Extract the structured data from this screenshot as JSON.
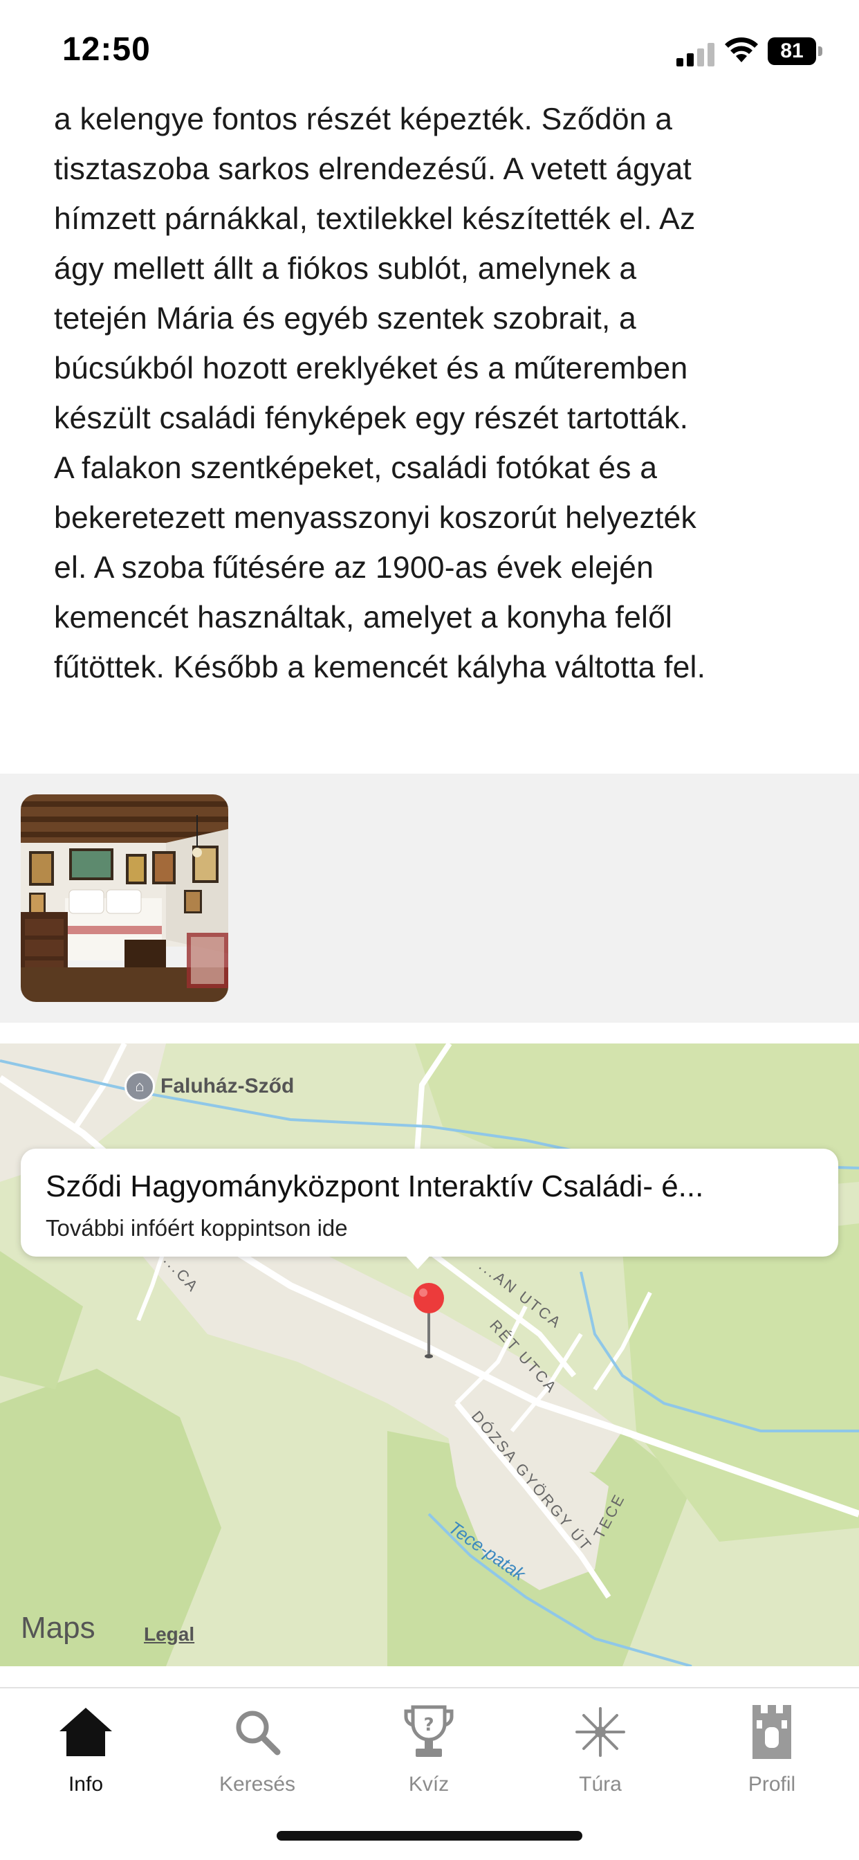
{
  "status_bar": {
    "time": "12:50",
    "battery_percent": "81"
  },
  "article": {
    "lines": [
      "a kelengye fontos részét képezték. Sződön a",
      "tisztaszoba sarkos elrendezésű. A vetett ágyat",
      "hímzett párnákkal, textilekkel készítették el. Az",
      "ágy mellett állt a fiókos sublót, amelynek a",
      "tetején Mária és egyéb szentek szobrait, a",
      "búcsúkból hozott ereklyéket és a műteremben",
      "készült családi fényképek egy részét tartották.",
      "A falakon szentképeket, családi fotókat és a",
      "bekeretezett menyasszonyi koszorút helyezték",
      "el. A szoba fűtésére az 1900-as évek elején",
      "kemencét használtak, amelyet a konyha felől",
      "fűtöttek. Később a kemencét kályha váltotta fel."
    ]
  },
  "map": {
    "poi_label": "Faluház-Sződ",
    "callout_title": "Sződi Hagyományközpont Interaktív Családi- é...",
    "callout_subtitle": "További infóért koppintson ide",
    "street_labels": [
      "...AN UTCA",
      "RÉT UTCA",
      "DÓZSA GYÖRGY ÚT",
      "TECE",
      "...CA"
    ],
    "stream_label": "Tece-patak",
    "brand": "Maps",
    "legal": "Legal"
  },
  "tabbar": {
    "tabs": [
      {
        "label": "Info",
        "icon": "house-icon",
        "active": true
      },
      {
        "label": "Keresés",
        "icon": "search-icon",
        "active": false
      },
      {
        "label": "Kvíz",
        "icon": "trophy-icon",
        "active": false
      },
      {
        "label": "Túra",
        "icon": "compass-star-icon",
        "active": false
      },
      {
        "label": "Profil",
        "icon": "tower-icon",
        "active": false
      }
    ]
  },
  "colors": {
    "map_land": "#dfe8c4",
    "map_green": "#c6dc9e",
    "map_water": "#8fc7e8",
    "pin_red": "#ec3b3b",
    "tab_active": "#111111",
    "tab_inactive": "#8b8b8b"
  }
}
